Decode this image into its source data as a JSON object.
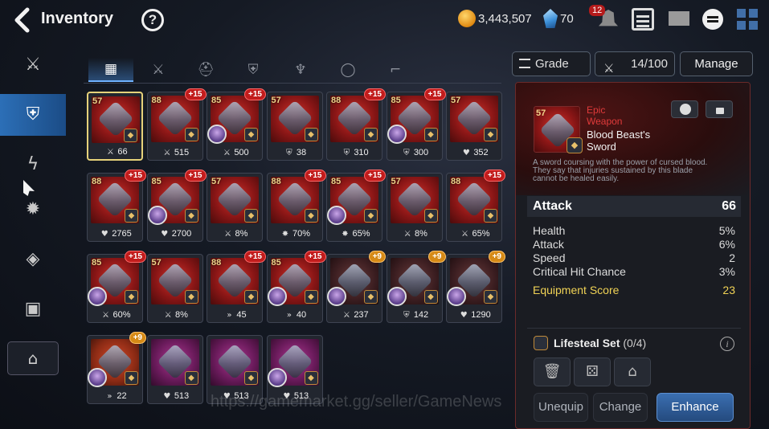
{
  "header": {
    "title": "Inventory",
    "help_glyph": "?",
    "gold": "3,443,507",
    "crystals": "70",
    "notification_count": "12"
  },
  "tabs": [
    {
      "icon": "all-items-icon",
      "glyph": "▦"
    },
    {
      "icon": "weapon-icon",
      "glyph": "⚔"
    },
    {
      "icon": "helmet-icon",
      "glyph": "⛑"
    },
    {
      "icon": "armor-icon",
      "glyph": "⛨"
    },
    {
      "icon": "necklace-icon",
      "glyph": "♆"
    },
    {
      "icon": "ring-icon",
      "glyph": "◯"
    },
    {
      "icon": "boots-icon",
      "glyph": "⌐"
    }
  ],
  "sidebar": [
    {
      "icon": "equipment-icon",
      "glyph": "⚔"
    },
    {
      "icon": "gear-shield-icon",
      "glyph": "⛨"
    },
    {
      "icon": "lightning-icon",
      "glyph": "ϟ"
    },
    {
      "icon": "artifact-icon",
      "glyph": "✹"
    },
    {
      "icon": "materials-icon",
      "glyph": "◈"
    },
    {
      "icon": "chest-icon",
      "glyph": "▣"
    }
  ],
  "inventory": [
    {
      "level": "57",
      "plus": "",
      "stat_icon": "attack",
      "stat": "66",
      "art": "red",
      "owner": false
    },
    {
      "level": "88",
      "plus": "+15",
      "stat_icon": "attack",
      "stat": "515",
      "art": "red",
      "owner": false
    },
    {
      "level": "85",
      "plus": "+15",
      "stat_icon": "attack",
      "stat": "500",
      "art": "red",
      "owner": true
    },
    {
      "level": "57",
      "plus": "",
      "stat_icon": "defense",
      "stat": "38",
      "art": "red",
      "owner": false
    },
    {
      "level": "88",
      "plus": "+15",
      "stat_icon": "defense",
      "stat": "310",
      "art": "red",
      "owner": false
    },
    {
      "level": "85",
      "plus": "+15",
      "stat_icon": "defense",
      "stat": "300",
      "art": "red",
      "owner": true
    },
    {
      "level": "57",
      "plus": "",
      "stat_icon": "health",
      "stat": "352",
      "art": "red",
      "owner": false
    },
    {
      "level": "88",
      "plus": "+15",
      "stat_icon": "health",
      "stat": "2765",
      "art": "red",
      "owner": false
    },
    {
      "level": "85",
      "plus": "+15",
      "stat_icon": "health",
      "stat": "2700",
      "art": "red",
      "owner": true
    },
    {
      "level": "57",
      "plus": "",
      "stat_icon": "attack",
      "stat": "8%",
      "art": "red",
      "owner": false
    },
    {
      "level": "88",
      "plus": "+15",
      "stat_icon": "crit",
      "stat": "70%",
      "art": "red",
      "owner": false
    },
    {
      "level": "85",
      "plus": "+15",
      "stat_icon": "crit",
      "stat": "65%",
      "art": "red",
      "owner": true
    },
    {
      "level": "57",
      "plus": "",
      "stat_icon": "attack",
      "stat": "8%",
      "art": "red",
      "owner": false
    },
    {
      "level": "88",
      "plus": "+15",
      "stat_icon": "attack",
      "stat": "65%",
      "art": "red",
      "owner": false
    },
    {
      "level": "85",
      "plus": "+15",
      "stat_icon": "attack",
      "stat": "60%",
      "art": "red",
      "owner": true
    },
    {
      "level": "57",
      "plus": "",
      "stat_icon": "attack",
      "stat": "8%",
      "art": "red",
      "owner": false
    },
    {
      "level": "88",
      "plus": "+15",
      "stat_icon": "speed",
      "stat": "45",
      "art": "red",
      "owner": false
    },
    {
      "level": "85",
      "plus": "+15",
      "stat_icon": "speed",
      "stat": "40",
      "art": "red",
      "owner": true
    },
    {
      "level": "",
      "plus": "+9",
      "stat_icon": "attack",
      "stat": "237",
      "art": "dark",
      "owner": true
    },
    {
      "level": "",
      "plus": "+9",
      "stat_icon": "defense",
      "stat": "142",
      "art": "dark",
      "owner": true
    },
    {
      "level": "",
      "plus": "+9",
      "stat_icon": "health",
      "stat": "1290",
      "art": "dark",
      "owner": true
    },
    {
      "level": "",
      "plus": "+9",
      "stat_icon": "speed",
      "stat": "22",
      "art": "orange",
      "owner": true
    },
    {
      "level": "",
      "plus": "",
      "stat_icon": "health",
      "stat": "513",
      "art": "purple",
      "owner": false
    },
    {
      "level": "",
      "plus": "",
      "stat_icon": "health",
      "stat": "513",
      "art": "purple",
      "owner": false
    },
    {
      "level": "",
      "plus": "",
      "stat_icon": "health",
      "stat": "513",
      "art": "purple",
      "owner": true
    }
  ],
  "stat_glyphs": {
    "attack": "⚔",
    "defense": "⛨",
    "health": "♥",
    "crit": "✸",
    "speed": "»"
  },
  "filter": {
    "grade_label": "Grade",
    "count": "14/100",
    "manage_label": "Manage"
  },
  "detail": {
    "level": "57",
    "rarity_line1": "Epic",
    "rarity_line2": "Weapon",
    "name_line1": "Blood Beast's",
    "name_line2": "Sword",
    "desc_line1": "A sword coursing with the power of cursed blood.",
    "desc_line2": "They say that injuries sustained by this blade",
    "desc_line3": "cannot be healed easily.",
    "main_stat": {
      "label": "Attack",
      "value": "66"
    },
    "sub_stats": [
      {
        "label": "Health",
        "value": "5%"
      },
      {
        "label": "Attack",
        "value": "6%"
      },
      {
        "label": "Speed",
        "value": "2"
      },
      {
        "label": "Critical Hit Chance",
        "value": "3%"
      }
    ],
    "score": {
      "label": "Equipment Score",
      "value": "23"
    },
    "set": {
      "name": "Lifesteal Set",
      "progress": "(0/4)"
    },
    "info_glyph": "i",
    "buttons": {
      "unequip": "Unequip",
      "change": "Change",
      "enhance": "Enhance"
    },
    "action_glyphs": {
      "discard": "🗑",
      "dice": "⚄",
      "storage": "⌂"
    }
  },
  "sidebar_bottom_glyph": "⌂",
  "watermark": "https://gamemarket.gg/seller/GameNews"
}
